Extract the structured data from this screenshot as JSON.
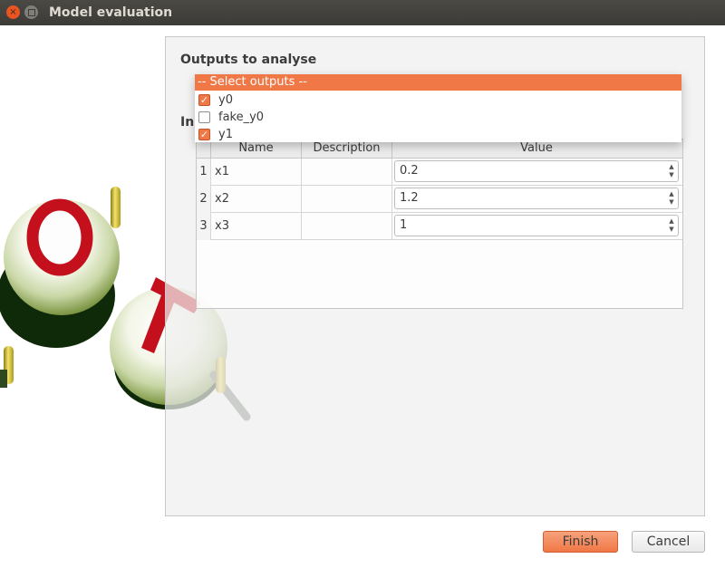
{
  "window": {
    "title": "Model evaluation",
    "close_glyph": "×"
  },
  "outputs": {
    "title": "Outputs to analyse",
    "dropdown_header": "-- Select outputs --",
    "items": [
      {
        "label": "y0",
        "checked": true
      },
      {
        "label": "fake_y0",
        "checked": false
      },
      {
        "label": "y1",
        "checked": true
      }
    ]
  },
  "inputs": {
    "title_partial": "Inp"
  },
  "table": {
    "columns": [
      "Name",
      "Description",
      "Value"
    ],
    "rows": [
      {
        "index": "1",
        "name": "x1",
        "description": "",
        "value": "0.2"
      },
      {
        "index": "2",
        "name": "x2",
        "description": "",
        "value": "1.2"
      },
      {
        "index": "3",
        "name": "x3",
        "description": "",
        "value": "1"
      }
    ]
  },
  "buttons": {
    "finish": "Finish",
    "cancel": "Cancel"
  },
  "colors": {
    "accent": "#f07746",
    "titlebar": "#3c3b37"
  },
  "icons": {
    "close": "close-icon",
    "maximize": "maximize-icon",
    "checkbox_checked": "check-icon",
    "spin_up": "chevron-up-icon",
    "spin_down": "chevron-down-icon"
  }
}
